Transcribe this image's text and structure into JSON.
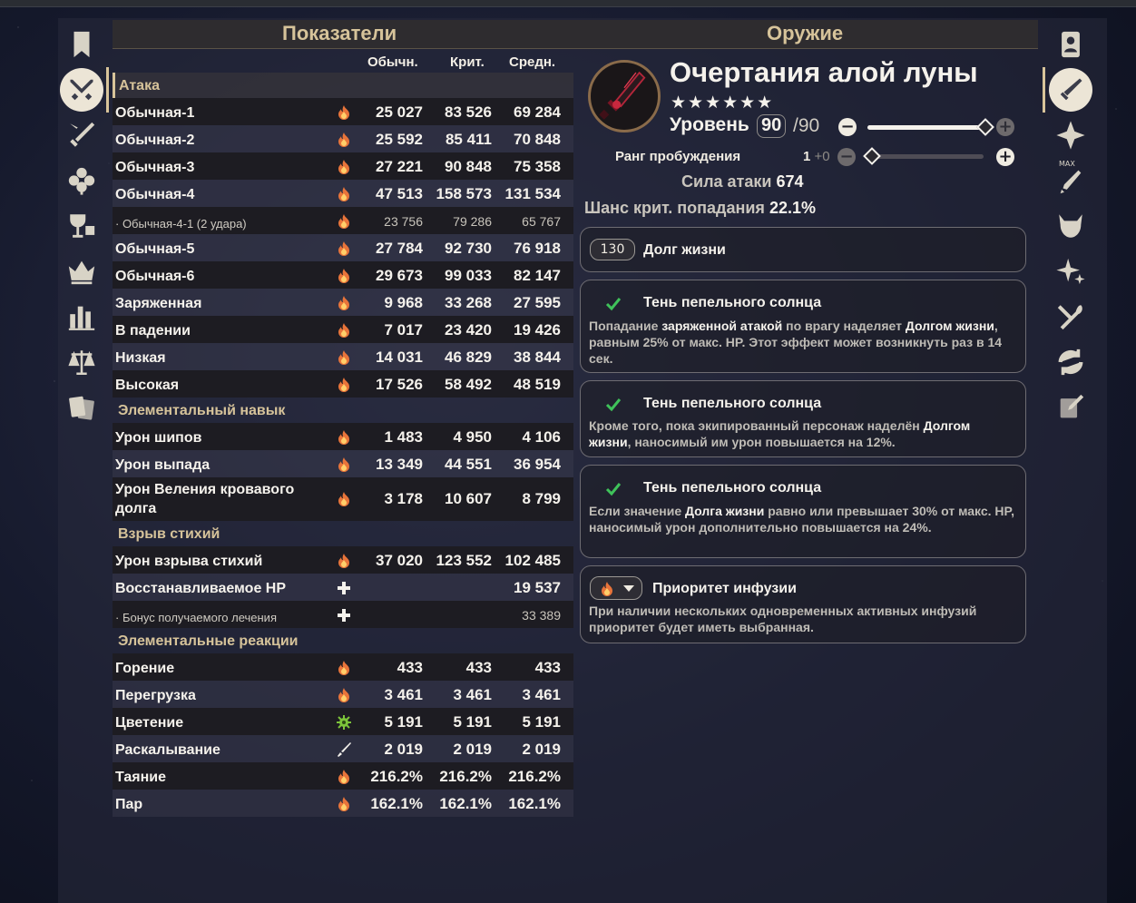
{
  "headers": {
    "stats": "Показатели",
    "weapon": "Оружие"
  },
  "columns": {
    "normal": "Обычн.",
    "crit": "Крит.",
    "avg": "Средн."
  },
  "sections": {
    "attack": "Атака",
    "skill": "Элементальный навык",
    "burst": "Взрыв стихий",
    "reactions": "Элементальные реакции"
  },
  "attack_rows": [
    {
      "label": "Обычная-1",
      "icon": "pyro-icon",
      "normal": "25 027",
      "crit": "83 526",
      "avg": "69 284"
    },
    {
      "label": "Обычная-2",
      "icon": "pyro-icon",
      "normal": "25 592",
      "crit": "85 411",
      "avg": "70 848"
    },
    {
      "label": "Обычная-3",
      "icon": "pyro-icon",
      "normal": "27 221",
      "crit": "90 848",
      "avg": "75 358"
    },
    {
      "label": "Обычная-4",
      "icon": "pyro-icon",
      "normal": "47 513",
      "crit": "158 573",
      "avg": "131 534"
    },
    {
      "label": "· Обычная-4-1 (2 удара)",
      "icon": "pyro-icon",
      "normal": "23 756",
      "crit": "79 286",
      "avg": "65 767"
    },
    {
      "label": "Обычная-5",
      "icon": "pyro-icon",
      "normal": "27 784",
      "crit": "92 730",
      "avg": "76 918"
    },
    {
      "label": "Обычная-6",
      "icon": "pyro-icon",
      "normal": "29 673",
      "crit": "99 033",
      "avg": "82 147"
    },
    {
      "label": "Заряженная",
      "icon": "pyro-icon",
      "normal": "9 968",
      "crit": "33 268",
      "avg": "27 595"
    },
    {
      "label": "В падении",
      "icon": "pyro-icon",
      "normal": "7 017",
      "crit": "23 420",
      "avg": "19 426"
    },
    {
      "label": "Низкая",
      "icon": "pyro-icon",
      "normal": "14 031",
      "crit": "46 829",
      "avg": "38 844"
    },
    {
      "label": "Высокая",
      "icon": "pyro-icon",
      "normal": "17 526",
      "crit": "58 492",
      "avg": "48 519"
    }
  ],
  "skill_rows": [
    {
      "label": "Урон шипов",
      "icon": "pyro-icon",
      "normal": "1 483",
      "crit": "4 950",
      "avg": "4 106"
    },
    {
      "label": "Урон выпада",
      "icon": "pyro-icon",
      "normal": "13 349",
      "crit": "44 551",
      "avg": "36 954"
    },
    {
      "label": "Урон Веления кровавого долга",
      "icon": "pyro-icon",
      "normal": "3 178",
      "crit": "10 607",
      "avg": "8 799"
    }
  ],
  "burst_rows": [
    {
      "label": "Урон взрыва стихий",
      "icon": "pyro-icon",
      "normal": "37 020",
      "crit": "123 552",
      "avg": "102 485"
    },
    {
      "label": "Восстанавливаемое HP",
      "icon": "heal-plus-icon",
      "normal": "",
      "crit": "",
      "avg": "19 537"
    },
    {
      "label": "· Бонус получаемого лечения",
      "icon": "heal-plus-icon",
      "normal": "",
      "crit": "",
      "avg": "33 389"
    }
  ],
  "reaction_rows": [
    {
      "label": "Горение",
      "icon": "pyro-icon",
      "normal": "433",
      "crit": "433",
      "avg": "433"
    },
    {
      "label": "Перегрузка",
      "icon": "pyro-icon",
      "normal": "3 461",
      "crit": "3 461",
      "avg": "3 461"
    },
    {
      "label": "Цветение",
      "icon": "dendro-icon",
      "normal": "5 191",
      "crit": "5 191",
      "avg": "5 191"
    },
    {
      "label": "Раскалывание",
      "icon": "physical-blade-icon",
      "normal": "2 019",
      "crit": "2 019",
      "avg": "2 019"
    },
    {
      "label": "Таяние",
      "icon": "pyro-icon",
      "normal": "216.2%",
      "crit": "216.2%",
      "avg": "216.2%"
    },
    {
      "label": "Пар",
      "icon": "pyro-icon",
      "normal": "162.1%",
      "crit": "162.1%",
      "avg": "162.1%"
    }
  ],
  "weapon": {
    "name": "Очертания алой луны",
    "stars": "★★★★★★",
    "level_label": "Уровень",
    "level": "90",
    "level_max": "/90",
    "level_fraction": 1.0,
    "refine_label": "Ранг пробуждения",
    "refine_value": "1",
    "refine_bonus": "+0",
    "refine_fraction": 0.0,
    "atk_label": "Сила атаки",
    "atk_value": "674",
    "crit_label": "Шанс крит. попадания",
    "crit_value": "22.1%"
  },
  "cards": {
    "bond": {
      "pill": "130",
      "title": "Долг жизни"
    },
    "passive1": {
      "title": "Тень пепельного солнца",
      "desc_a": "Попадание ",
      "desc_b": "заряженной атакой",
      "desc_c": " по врагу наделяет ",
      "desc_d": "Долгом жизни",
      "desc_e": ", равным 25% от макс. HP. Этот эффект может возникнуть раз в 14 сек."
    },
    "passive2": {
      "title": "Тень пепельного солнца",
      "desc_a": "Кроме того, пока экипированный персонаж наделён ",
      "desc_b": "Долгом жизни",
      "desc_c": ", наносимый им урон повышается на 12%."
    },
    "passive3": {
      "title": "Тень пепельного солнца",
      "desc_a": "Если значение ",
      "desc_b": "Долга жизни",
      "desc_c": " равно или превышает 30% от макс. HP, наносимый урон дополнительно повышается на 24%."
    },
    "infusion": {
      "title": "Приоритет инфузии",
      "desc": "При наличии нескольких одновременных активных инфузий приоритет будет иметь выбранная."
    }
  },
  "rails": {
    "left": [
      "bookmark-icon",
      "crossed-swords-icon",
      "sword-slash-icon",
      "flower-artifact-icon",
      "goblet-dice-icon",
      "crown-icon",
      "bar-chart-icon",
      "scales-icon",
      "cards-icon"
    ],
    "right": [
      "character-card-icon",
      "weapon-icon",
      "compass-star-icon",
      "max-level-icon",
      "horned-enemy-icon",
      "sparkle-icon",
      "fork-spoon-icon",
      "refresh-icon",
      "card-edit-icon"
    ],
    "right_max_tag": "MAX"
  },
  "colors": {
    "accent": "#d6c39a",
    "pyro": "#e8743a",
    "dendro": "#7cc43a"
  }
}
